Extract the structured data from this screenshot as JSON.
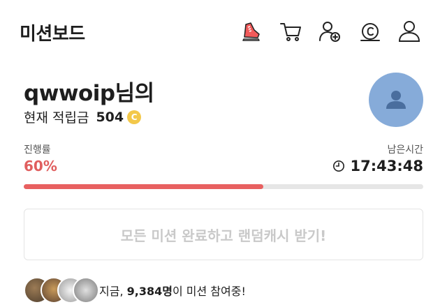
{
  "header": {
    "title": "미션보드",
    "icons": [
      "sneaker-icon",
      "cart-icon",
      "add-user-icon",
      "coin-icon",
      "profile-icon"
    ],
    "accent_color": "#f15a5a"
  },
  "user": {
    "name": "qwwoip님의",
    "points_label": "현재 적립금",
    "points_value": "504",
    "coin_symbol": "C",
    "avatar_color": "#86abd9"
  },
  "progress": {
    "label": "진행률",
    "value_text": "60%",
    "fraction": 0.6,
    "remaining_label": "남은시간",
    "remaining_time": "17:43:48",
    "bar_color": "#e86060"
  },
  "reward_button": {
    "label": "모든 미션 완료하고 랜덤캐시 받기!"
  },
  "participants": {
    "prefix": "지금, ",
    "count": "9,384명",
    "suffix": "이 미션 참여중!"
  }
}
